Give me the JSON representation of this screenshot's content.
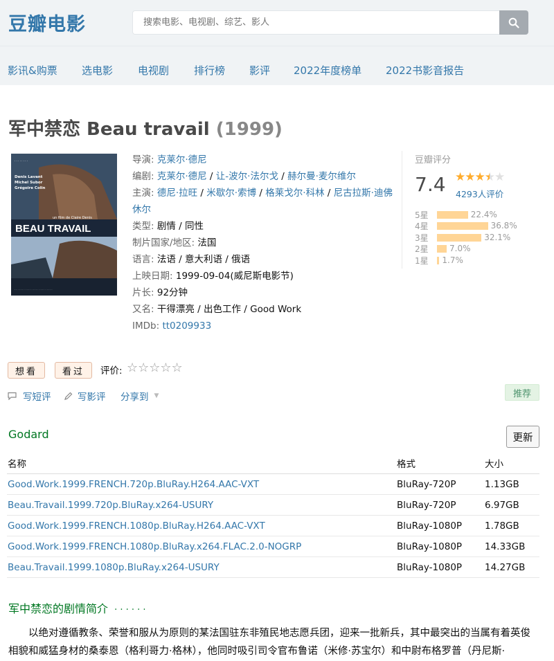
{
  "header": {
    "logo": "豆瓣电影",
    "search_placeholder": "搜索电影、电视剧、综艺、影人",
    "search_icon": "search-icon"
  },
  "nav": [
    "影讯&购票",
    "选电影",
    "电视剧",
    "排行榜",
    "影评",
    "2022年度榜单",
    "2022书影音报告"
  ],
  "movie": {
    "title": "军中禁恋 Beau travail",
    "year": "(1999)",
    "poster": {
      "title_text": "BEAU TRAVAIL",
      "cast_text": "Denis Lavant\nMichel Subor\nGrégoire Colin",
      "director_text": "un film de Claire Denis"
    },
    "info": {
      "director_label": "导演",
      "director": "克莱尔·德尼",
      "writer_label": "编剧",
      "writers": [
        "克莱尔·德尼",
        "让-波尔·法尔戈",
        "赫尔曼·麦尔维尔"
      ],
      "cast_label": "主演",
      "cast": [
        "德尼·拉旺",
        "米歇尔·索博",
        "格莱戈尔·科林",
        "尼古拉斯·迪佛休尔"
      ],
      "genre_label": "类型:",
      "genre": "剧情 / 同性",
      "country_label": "制片国家/地区:",
      "country": "法国",
      "language_label": "语言:",
      "language": "法语 / 意大利语 / 俄语",
      "release_label": "上映日期:",
      "release": "1999-09-04(威尼斯电影节)",
      "runtime_label": "片长:",
      "runtime": "92分钟",
      "aka_label": "又名:",
      "aka": "干得漂亮 / 出色工作 / Good Work",
      "imdb_label": "IMDb:",
      "imdb": "tt0209933"
    }
  },
  "rating": {
    "label": "豆瓣评分",
    "score": "7.4",
    "stars": 3.5,
    "votes": "4293人评价",
    "distribution": [
      {
        "label": "5星",
        "pct_text": "22.4%",
        "pct": 22.4
      },
      {
        "label": "4星",
        "pct_text": "36.8%",
        "pct": 36.8
      },
      {
        "label": "3星",
        "pct_text": "32.1%",
        "pct": 32.1
      },
      {
        "label": "2星",
        "pct_text": "7.0%",
        "pct": 7.0
      },
      {
        "label": "1星",
        "pct_text": "1.7%",
        "pct": 1.7
      }
    ]
  },
  "actions": {
    "want": "想看",
    "seen": "看过",
    "rate_label": "评价:",
    "rate_stars": "☆☆☆☆☆",
    "short_review": "写短评",
    "review": "写影评",
    "share": "分享到",
    "recommend": "推荐"
  },
  "downloads": {
    "section_title": "Godard",
    "refresh": "更新",
    "headers": [
      "名称",
      "格式",
      "大小"
    ],
    "rows": [
      {
        "name": "Good.Work.1999.FRENCH.720p.BluRay.H264.AAC-VXT",
        "format": "BluRay-720P",
        "size": "1.13GB"
      },
      {
        "name": "Beau.Travail.1999.720p.BluRay.x264-USURY",
        "format": "BluRay-720P",
        "size": "6.97GB"
      },
      {
        "name": "Good.Work.1999.FRENCH.1080p.BluRay.H264.AAC-VXT",
        "format": "BluRay-1080P",
        "size": "1.78GB"
      },
      {
        "name": "Good.Work.1999.FRENCH.1080p.BluRay.x264.FLAC.2.0-NOGRP",
        "format": "BluRay-1080P",
        "size": "14.33GB"
      },
      {
        "name": "Beau.Travail.1999.1080p.BluRay.x264-USURY",
        "format": "BluRay-1080P",
        "size": "14.27GB"
      }
    ]
  },
  "summary": {
    "title": "军中禁恋的剧情简介",
    "dots": "· · · · · ·",
    "text": "以绝对遵循教条、荣誉和服从为原则的某法国驻东非殖民地志愿兵团，迎来一批新兵，其中最突出的当属有着英俊相貌和威猛身材的桑泰恩（格利哥力·格林），他同时吸引司令官布鲁诺（米修·苏宝尔）和中尉布格罗普（丹尼斯·"
  }
}
